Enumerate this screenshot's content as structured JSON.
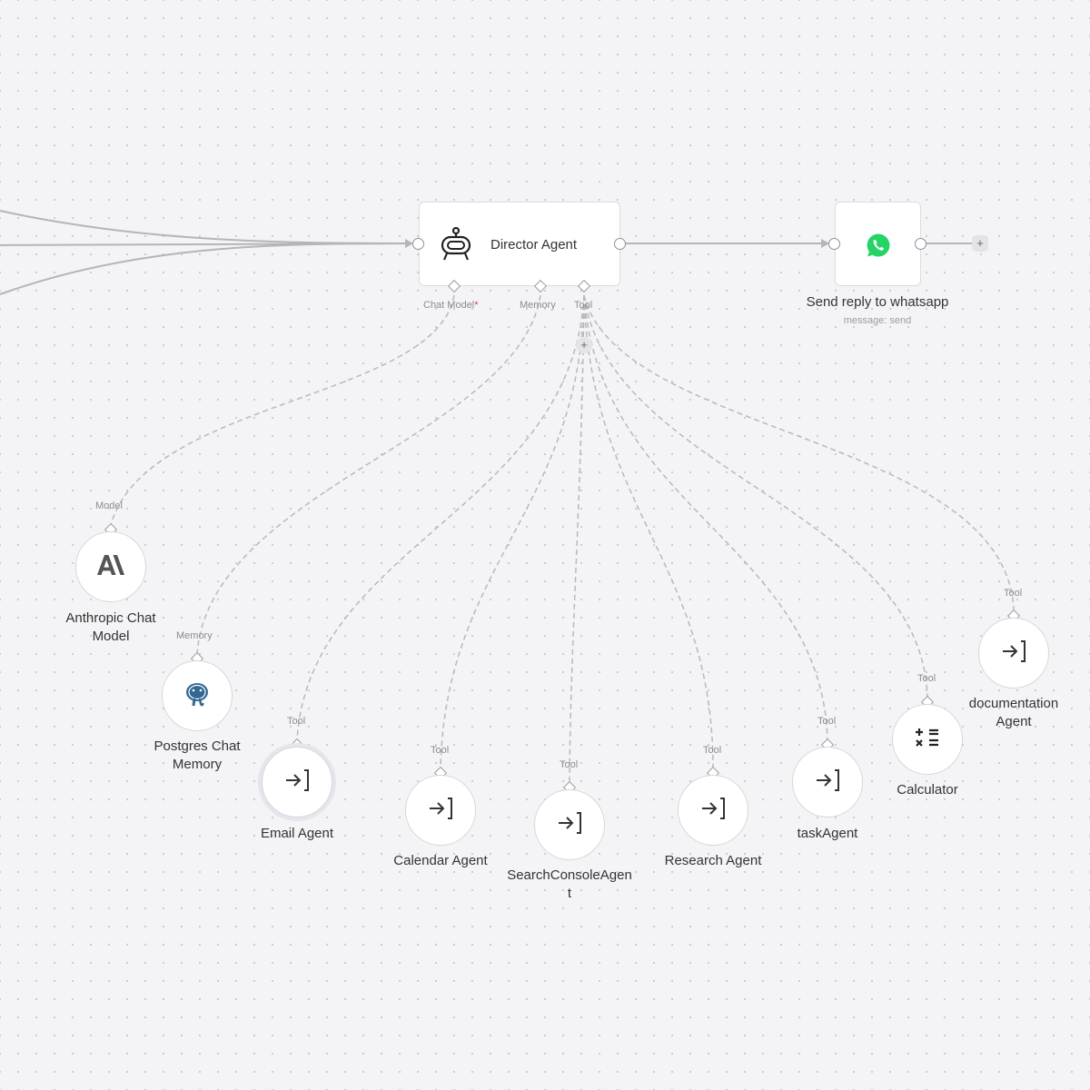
{
  "director": {
    "title": "Director Agent",
    "ports": {
      "chat_model": "Chat Model",
      "required_marker": "*",
      "memory": "Memory",
      "tool": "Tool"
    },
    "add_tool_label": "+"
  },
  "whatsapp": {
    "title": "Send reply to whatsapp",
    "subtitle": "message: send",
    "add_label": "+",
    "icon": "whatsapp-icon",
    "brand_color": "#25d366"
  },
  "subnodes": {
    "anthropic": {
      "title_line1": "Anthropic Chat",
      "title_line2": "Model",
      "port": "Model",
      "icon": "anthropic-icon"
    },
    "postgres": {
      "title_line1": "Postgres Chat",
      "title_line2": "Memory",
      "port": "Memory",
      "icon": "postgres-elephant-icon"
    },
    "email": {
      "title": "Email Agent",
      "port": "Tool"
    },
    "calendar": {
      "title": "Calendar Agent",
      "port": "Tool"
    },
    "searchconsole": {
      "title_line1": "SearchConsoleAgen",
      "title_line2": "t",
      "port": "Tool"
    },
    "research": {
      "title": "Research Agent",
      "port": "Tool"
    },
    "task": {
      "title": "taskAgent",
      "port": "Tool"
    },
    "calculator": {
      "title": "Calculator",
      "port": "Tool",
      "icon": "calculator-icon"
    },
    "documentation": {
      "title_line1": "documentation",
      "title_line2": "Agent",
      "port": "Tool"
    }
  },
  "colors": {
    "edge_main": "#b4b4ba",
    "edge_dashed": "#b8b8be",
    "required": "#e0424d",
    "text": "#333333"
  }
}
